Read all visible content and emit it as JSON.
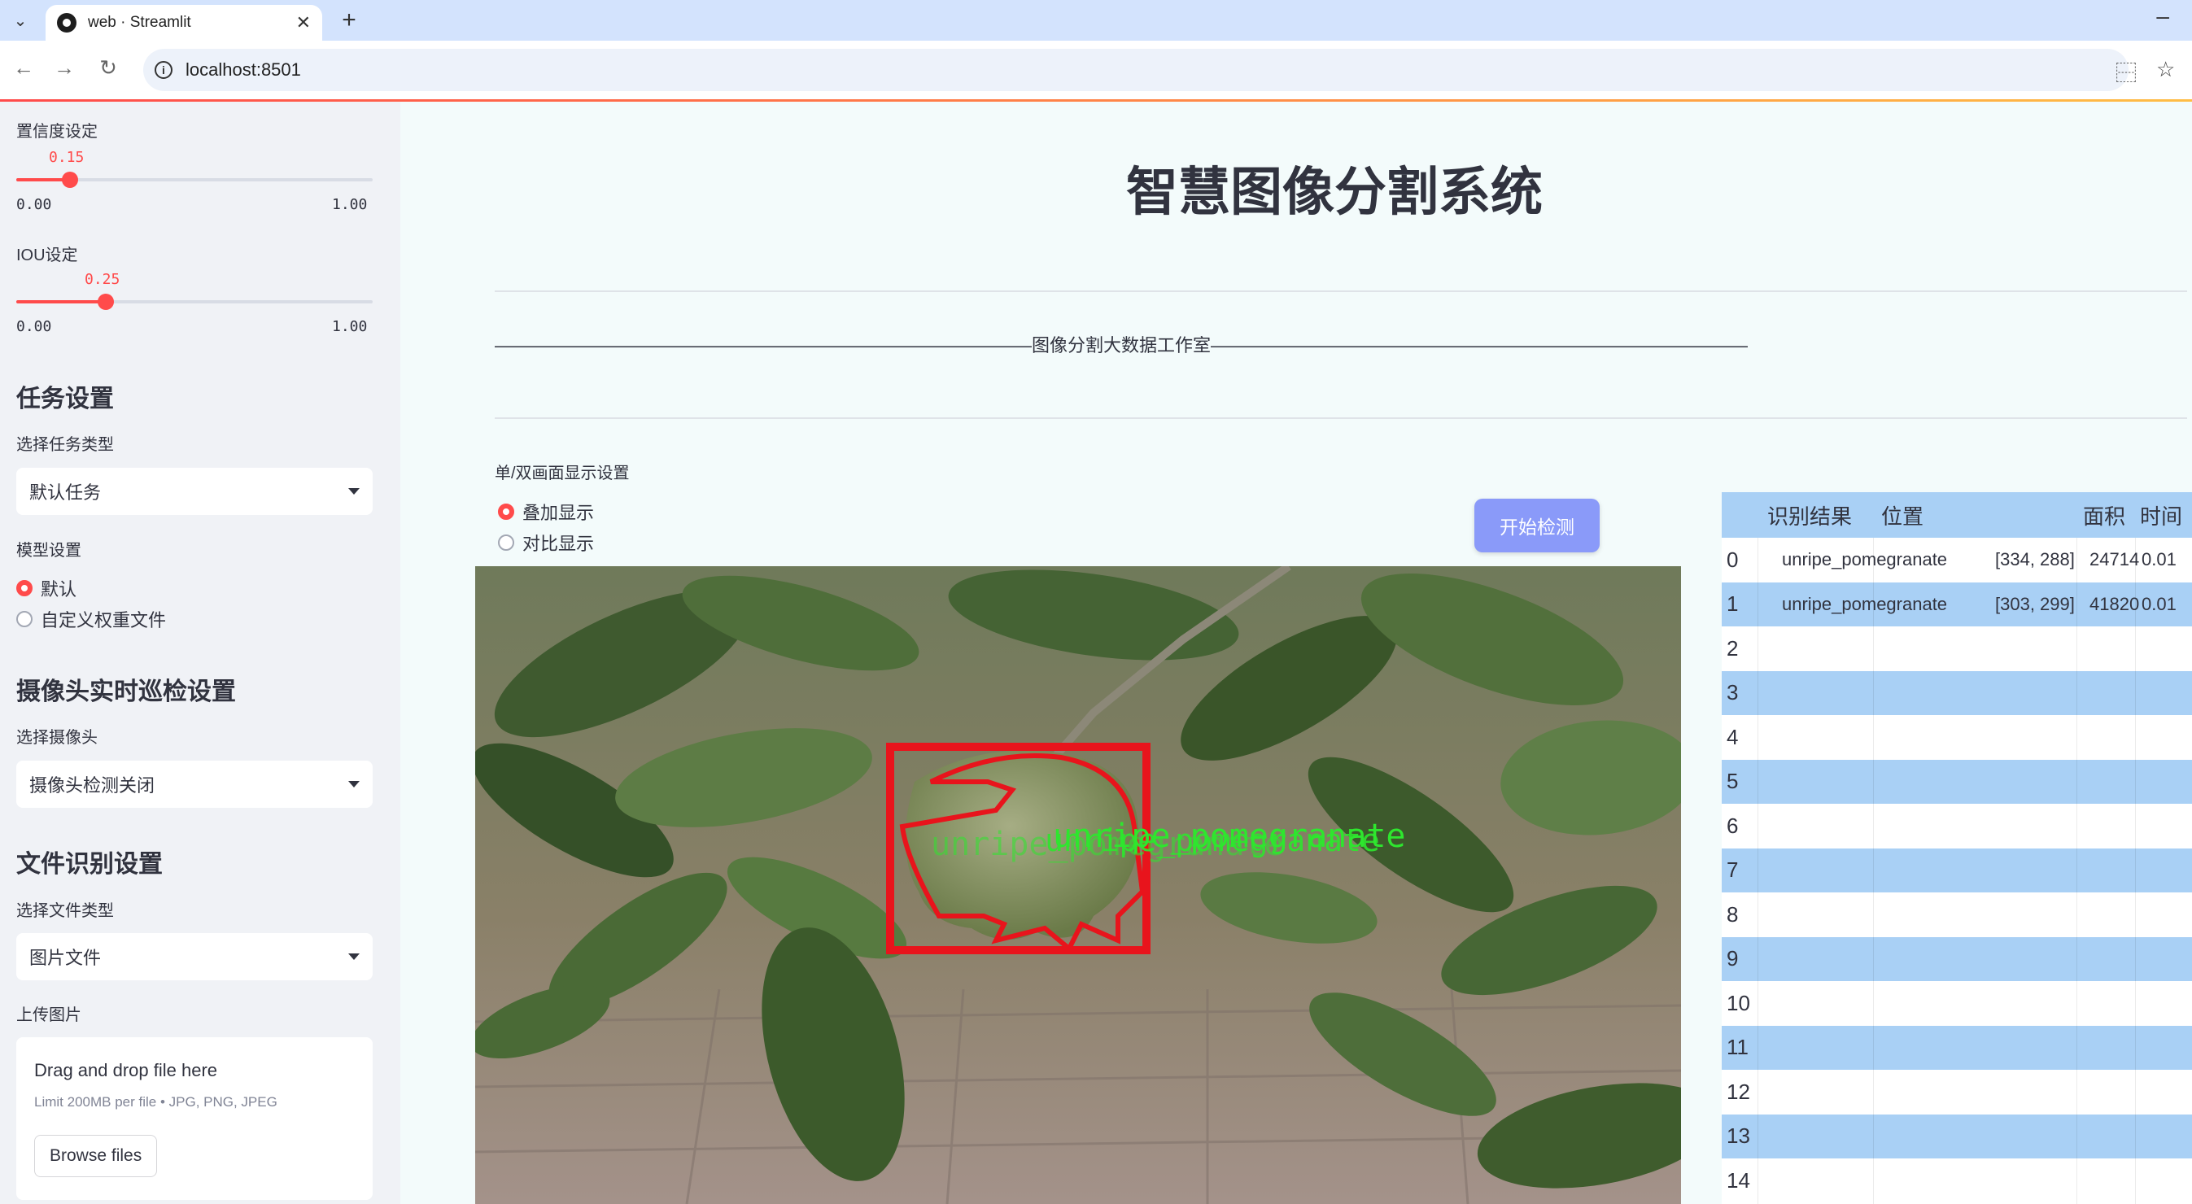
{
  "browser": {
    "tab_title": "web · Streamlit",
    "url": "localhost:8501"
  },
  "sidebar": {
    "confidence": {
      "label": "置信度设定",
      "value": "0.15",
      "min": "0.00",
      "max": "1.00",
      "fraction": 0.15
    },
    "iou": {
      "label": "IOU设定",
      "value": "0.25",
      "min": "0.00",
      "max": "1.00",
      "fraction": 0.25
    },
    "task_heading": "任务设置",
    "task_type_label": "选择任务类型",
    "task_type_value": "默认任务",
    "model_label": "模型设置",
    "model_options": [
      "默认",
      "自定义权重文件"
    ],
    "camera_heading": "摄像头实时巡检设置",
    "camera_label": "选择摄像头",
    "camera_value": "摄像头检测关闭",
    "file_heading": "文件识别设置",
    "file_type_label": "选择文件类型",
    "file_type_value": "图片文件",
    "upload_label": "上传图片",
    "upload_main": "Drag and drop file here",
    "upload_sub": "Limit 200MB per file • JPG, PNG, JPEG",
    "browse_label": "Browse files"
  },
  "main": {
    "title": "智慧图像分割系统",
    "divider_text": "——————————————————————————————图像分割大数据工作室——————————————————————————————",
    "display_mode_label": "单/双画面显示设置",
    "display_modes": [
      "叠加显示",
      "对比显示"
    ],
    "start_button": "开始检测",
    "detection_label": "unripe_pomegranate"
  },
  "results_table": {
    "headers": [
      "识别结果",
      "位置",
      "面积",
      "时间"
    ],
    "rows": [
      {
        "index": "0",
        "label": "unripe_pomegranate",
        "position": "[334, 288]",
        "area": "24714",
        "time": "0.01"
      },
      {
        "index": "1",
        "label": "unripe_pomegranate",
        "position": "[303, 299]",
        "area": "41820",
        "time": "0.01"
      },
      {
        "index": "2"
      },
      {
        "index": "3"
      },
      {
        "index": "4"
      },
      {
        "index": "5"
      },
      {
        "index": "6"
      },
      {
        "index": "7"
      },
      {
        "index": "8"
      },
      {
        "index": "9"
      },
      {
        "index": "10"
      },
      {
        "index": "11"
      },
      {
        "index": "12"
      },
      {
        "index": "13"
      },
      {
        "index": "14"
      }
    ]
  },
  "colors": {
    "accent": "#ff4b4b",
    "button": "#8a9af9",
    "table_stripe": "#a9d0f5",
    "detect_box": "#e8141c",
    "detect_text": "#2ee62e"
  }
}
